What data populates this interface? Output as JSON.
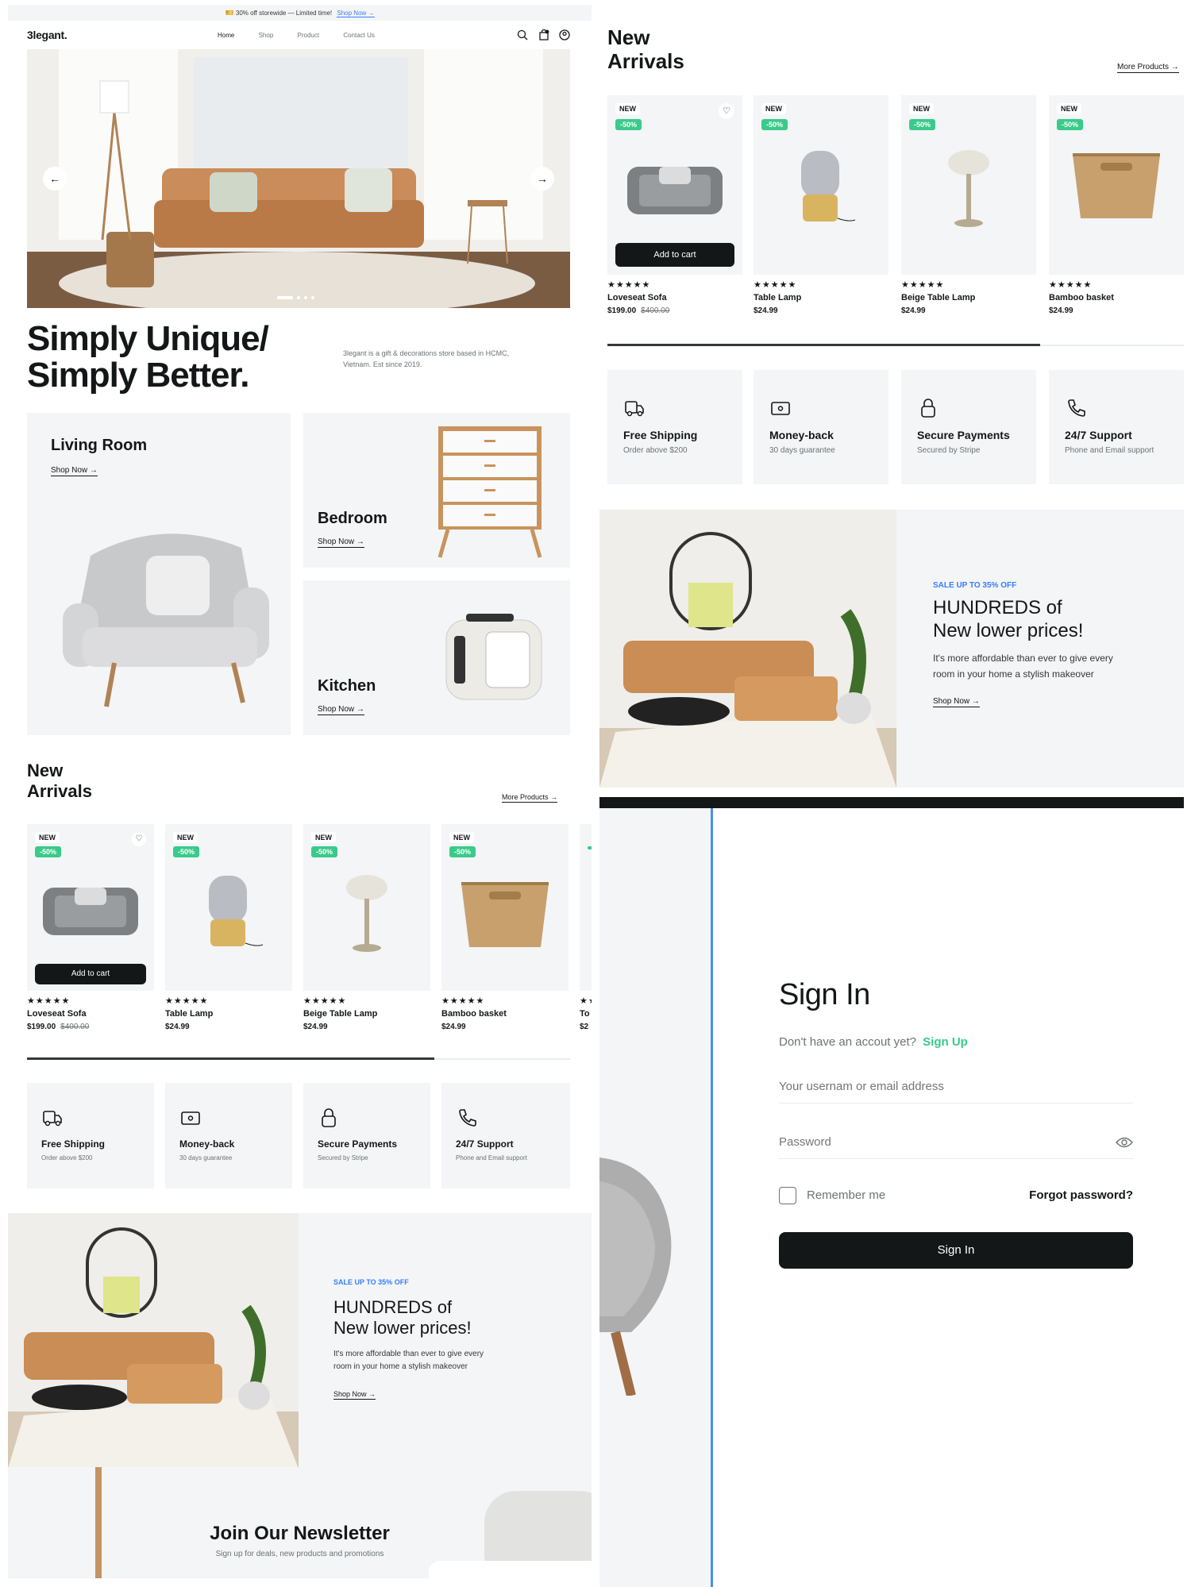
{
  "left": {
    "promo": {
      "text": "30% off storewide — Limited time!",
      "link": "Shop Now →"
    },
    "header": {
      "logo": "3legant.",
      "nav": [
        "Home",
        "Shop",
        "Product",
        "Contact Us"
      ]
    },
    "hero": {
      "dots_count": 4
    },
    "headline": {
      "line1": "Simply Unique/",
      "line2": "Simply Better.",
      "desc_line1": "3legant is a gift & decorations store based in HCMC,",
      "desc_line2": "Vietnam. Est since 2019."
    },
    "categories": [
      {
        "name": "Living Room",
        "link": "Shop Now →"
      },
      {
        "name": "Bedroom",
        "link": "Shop Now →"
      },
      {
        "name": "Kitchen",
        "link": "Shop Now →"
      }
    ],
    "new_arrivals": {
      "line1": "New",
      "line2": "Arrivals",
      "more": "More Products →"
    },
    "products": [
      {
        "badge_new": "NEW",
        "badge_off": "-50%",
        "stars": "★★★★★",
        "name": "Loveseat Sofa",
        "price": "$199.00",
        "old_price": "$400.00",
        "cta": "Add to cart"
      },
      {
        "badge_new": "NEW",
        "badge_off": "-50%",
        "stars": "★★★★★",
        "name": "Table Lamp",
        "price": "$24.99"
      },
      {
        "badge_new": "NEW",
        "badge_off": "-50%",
        "stars": "★★★★★",
        "name": "Beige Table Lamp",
        "price": "$24.99"
      },
      {
        "badge_new": "NEW",
        "badge_off": "-50%",
        "stars": "★★★★★",
        "name": "Bamboo basket",
        "price": "$24.99"
      },
      {
        "stars": "★★",
        "name": "To",
        "price": "$2"
      }
    ],
    "scroll_progress": 0.75,
    "features": [
      {
        "icon": "truck-icon",
        "title": "Free Shipping",
        "sub": "Order above $200"
      },
      {
        "icon": "money-icon",
        "title": "Money-back",
        "sub": "30 days guarantee"
      },
      {
        "icon": "lock-icon",
        "title": "Secure Payments",
        "sub": "Secured by Stripe"
      },
      {
        "icon": "phone-icon",
        "title": "24/7 Support",
        "sub": "Phone and Email support"
      }
    ],
    "banner": {
      "eyebrow": "SALE UP TO 35% OFF",
      "title1": "HUNDREDS of",
      "title2": "New lower prices!",
      "desc1": "It's more affordable than ever to give every",
      "desc2": "room in your home a stylish makeover",
      "link": "Shop Now →"
    },
    "newsletter": {
      "title": "Join Our Newsletter",
      "sub": "Sign up for deals, new products and promotions"
    }
  },
  "right": {
    "new_arrivals": {
      "line1": "New",
      "line2": "Arrivals",
      "more": "More Products →"
    },
    "products": [
      {
        "badge_new": "NEW",
        "badge_off": "-50%",
        "stars": "★★★★★",
        "name": "Loveseat Sofa",
        "price": "$199.00",
        "old_price": "$400.00",
        "cta": "Add to cart"
      },
      {
        "badge_new": "NEW",
        "badge_off": "-50%",
        "stars": "★★★★★",
        "name": "Table Lamp",
        "price": "$24.99"
      },
      {
        "badge_new": "NEW",
        "badge_off": "-50%",
        "stars": "★★★★★",
        "name": "Beige Table Lamp",
        "price": "$24.99"
      },
      {
        "badge_new": "NEW",
        "badge_off": "-50%",
        "stars": "★★★★★",
        "name": "Bamboo basket",
        "price": "$24.99"
      }
    ],
    "scroll_progress": 0.75,
    "features": [
      {
        "icon": "truck-icon",
        "title": "Free Shipping",
        "sub": "Order above $200"
      },
      {
        "icon": "money-icon",
        "title": "Money-back",
        "sub": "30 days guarantee"
      },
      {
        "icon": "lock-icon",
        "title": "Secure Payments",
        "sub": "Secured by Stripe"
      },
      {
        "icon": "phone-icon",
        "title": "24/7 Support",
        "sub": "Phone and Email support"
      }
    ],
    "banner": {
      "eyebrow": "SALE UP TO 35% OFF",
      "title1": "HUNDREDS of",
      "title2": "New lower prices!",
      "desc1": "It's more affordable than ever to give every",
      "desc2": "room in your home a stylish makeover",
      "link": "Shop Now →"
    },
    "signin": {
      "title": "Sign In",
      "prompt": "Don't have an accout yet?",
      "signup": "Sign Up",
      "username_placeholder": "Your usernam or email address",
      "password_placeholder": "Password",
      "remember": "Remember me",
      "forgot": "Forgot password?",
      "button": "Sign In"
    }
  },
  "colors": {
    "dark": "#141718",
    "gray_bg": "#f3f5f7",
    "green": "#38cb89",
    "blue": "#377dff",
    "muted": "#6c7275"
  }
}
